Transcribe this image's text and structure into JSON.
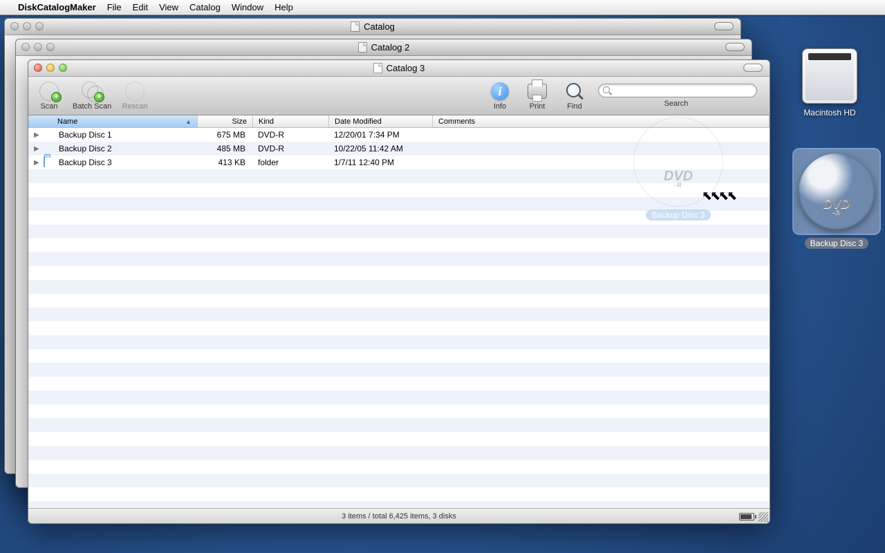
{
  "menubar": {
    "app": "DiskCatalogMaker",
    "items": [
      "File",
      "Edit",
      "View",
      "Catalog",
      "Window",
      "Help"
    ]
  },
  "windows": {
    "back1_title": "Catalog",
    "back2_title": "Catalog 2",
    "front_title": "Catalog 3"
  },
  "toolbar": {
    "scan": "Scan",
    "batch_scan": "Batch Scan",
    "rescan": "Rescan",
    "info": "Info",
    "print": "Print",
    "find": "Find",
    "search": "Search",
    "search_placeholder": ""
  },
  "columns": {
    "name": "Name",
    "size": "Size",
    "kind": "Kind",
    "date": "Date Modified",
    "comments": "Comments"
  },
  "rows": [
    {
      "name": "Backup Disc 1",
      "size": "675 MB",
      "kind": "DVD-R",
      "date": "12/20/01 7:34 PM",
      "icon": "disc"
    },
    {
      "name": "Backup Disc 2",
      "size": "485 MB",
      "kind": "DVD-R",
      "date": "10/22/05 11:42 AM",
      "icon": "disc"
    },
    {
      "name": "Backup Disc 3",
      "size": "413 KB",
      "kind": "folder",
      "date": "1/7/11 12:40 PM",
      "icon": "folder"
    }
  ],
  "drag_ghost": {
    "label": "Backup Disc 3",
    "brand": "DVD",
    "sub": "-R"
  },
  "status": "3 items / total 6,425 items, 3 disks",
  "desktop": {
    "hd_label": "Macintosh HD",
    "dvd_label": "Backup Disc 3",
    "dvd_brand": "DVD",
    "dvd_sub": "-R"
  }
}
